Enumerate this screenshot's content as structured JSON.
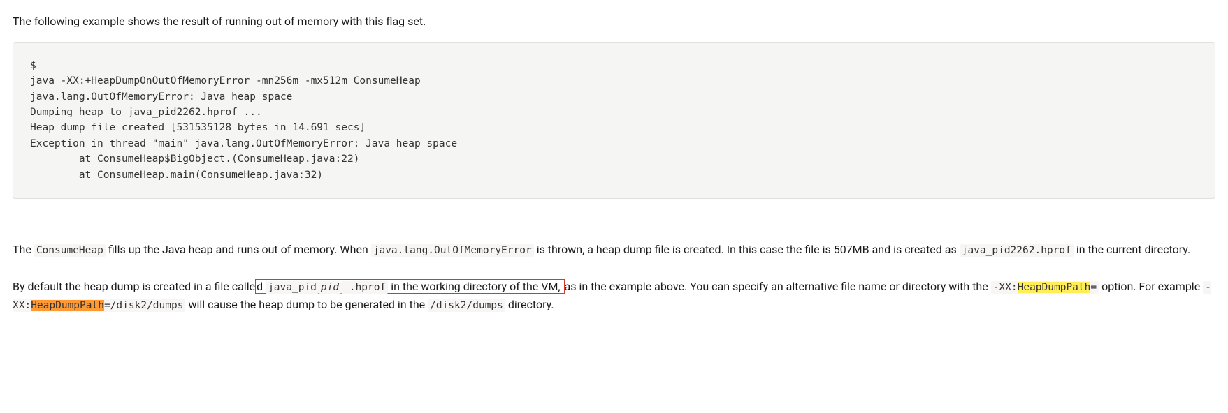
{
  "intro": "The following example shows the result of running out of memory with this flag set.",
  "code": "$ \njava -XX:+HeapDumpOnOutOfMemoryError -mn256m -mx512m ConsumeHeap\njava.lang.OutOfMemoryError: Java heap space\nDumping heap to java_pid2262.hprof ...\nHeap dump file created [531535128 bytes in 14.691 secs]\nException in thread \"main\" java.lang.OutOfMemoryError: Java heap space\n        at ConsumeHeap$BigObject.(ConsumeHeap.java:22)\n        at ConsumeHeap.main(ConsumeHeap.java:32)",
  "p2": {
    "t1": "The ",
    "c1": "ConsumeHeap",
    "t2": " fills up the Java heap and runs out of memory. When ",
    "c2": "java.lang.OutOfMemoryError",
    "t3": " is thrown, a heap dump file is created. In this case the file is 507MB and is created as ",
    "c3": "java_pid2262.hprof",
    "t4": " in the current directory."
  },
  "p3": {
    "t1": "By default the heap dump is created in a file calle",
    "box_d": "d ",
    "box_c1": "java_pid",
    "box_pid": "pid",
    "box_c2": " .hprof",
    "box_t2": " in the working directory of the VM, ",
    "t2": "as in the example above. You can specify an alternative file name or directory with the ",
    "c_xx1a": "-XX:",
    "hl1": "HeapDumpPath",
    "c_xx1b": "=",
    "t3": " option. For example ",
    "c_xx2a": "-XX:",
    "hl2": "HeapDumpPath",
    "c_xx2b": "=/disk2/dumps",
    "t4": " will cause the heap dump to be generated in the ",
    "c_dir": "/disk2/dumps",
    "t5": " directory."
  }
}
